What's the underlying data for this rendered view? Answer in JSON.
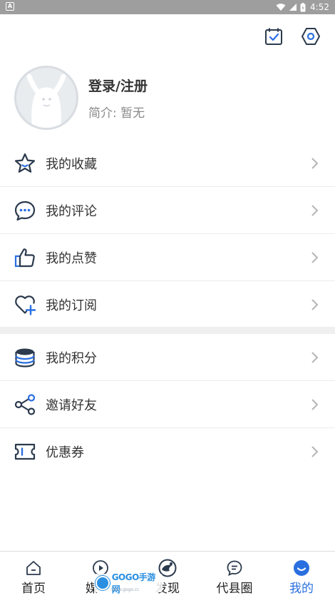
{
  "status_bar": {
    "time": "4:52",
    "icons": [
      "wifi-icon",
      "signal-icon",
      "battery-icon"
    ]
  },
  "header": {
    "icons": [
      "calendar-check-icon",
      "settings-hexagon-icon"
    ]
  },
  "profile": {
    "login_label": "登录/注册",
    "bio_label": "简介: 暂无"
  },
  "menu_group_1": [
    {
      "label": "我的收藏",
      "icon": "star-icon"
    },
    {
      "label": "我的评论",
      "icon": "comment-icon"
    },
    {
      "label": "我的点赞",
      "icon": "thumbs-up-icon"
    },
    {
      "label": "我的订阅",
      "icon": "heart-plus-icon"
    }
  ],
  "menu_group_2": [
    {
      "label": "我的积分",
      "icon": "coins-icon"
    },
    {
      "label": "邀请好友",
      "icon": "share-icon"
    },
    {
      "label": "优惠券",
      "icon": "coupon-icon"
    }
  ],
  "tabs": [
    {
      "label": "首页",
      "icon": "home-icon",
      "active": false
    },
    {
      "label": "媒",
      "icon": "play-icon",
      "active": false
    },
    {
      "label": "发现",
      "icon": "discover-icon",
      "active": false
    },
    {
      "label": "代县圈",
      "icon": "chat-icon",
      "active": false
    },
    {
      "label": "我的",
      "icon": "user-icon",
      "active": true
    }
  ],
  "watermark": {
    "text": "GOGO手游网",
    "sub": "www.gogo.cc"
  },
  "colors": {
    "accent": "#2a6fe0",
    "icon_dark": "#2b3a4d",
    "status_bar": "#9e9e9e"
  }
}
